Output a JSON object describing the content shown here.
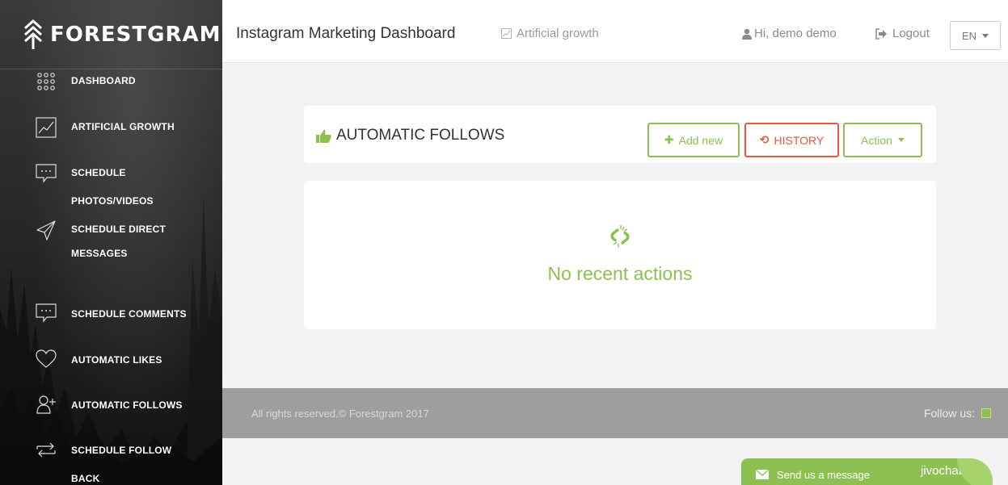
{
  "brand": {
    "name": "FORESTGRAM",
    "icon": "tree-logo-icon"
  },
  "sidebar": {
    "items": [
      {
        "label": "DASHBOARD",
        "icon": "dots-grid-icon"
      },
      {
        "label": "ARTIFICIAL GROWTH",
        "icon": "chart-line-icon"
      },
      {
        "label": "SCHEDULE PHOTOS/VIDEOS",
        "icon": "speech-bubble-icon"
      },
      {
        "label": "SCHEDULE DIRECT MESSAGES",
        "icon": "paper-plane-icon"
      },
      {
        "label": "SCHEDULE COMMENTS",
        "icon": "comment-icon"
      },
      {
        "label": "AUTOMATIC LIKES",
        "icon": "heart-icon"
      },
      {
        "label": "AUTOMATIC FOLLOWS",
        "icon": "user-plus-icon"
      },
      {
        "label": "SCHEDULE FOLLOW BACK",
        "icon": "repeat-icon"
      }
    ]
  },
  "header": {
    "title": "Instagram Marketing Dashboard",
    "breadcrumb": "Artificial growth",
    "greeting": "Hi, demo demo",
    "logout": "Logout",
    "language": "EN"
  },
  "panel": {
    "title": "AUTOMATIC FOLLOWS",
    "add_new": "Add new",
    "history": "HISTORY",
    "action": "Action",
    "empty_text": "No recent actions"
  },
  "footer": {
    "copyright": "All rights reserved.© Forestgram 2017",
    "follow_us": "Follow us:"
  },
  "chat": {
    "prompt": "Send us a message",
    "brand": "jivochat"
  },
  "colors": {
    "accent_green": "#8cc152",
    "accent_red": "#e9573f",
    "footer_gray": "#9e9e9e"
  }
}
